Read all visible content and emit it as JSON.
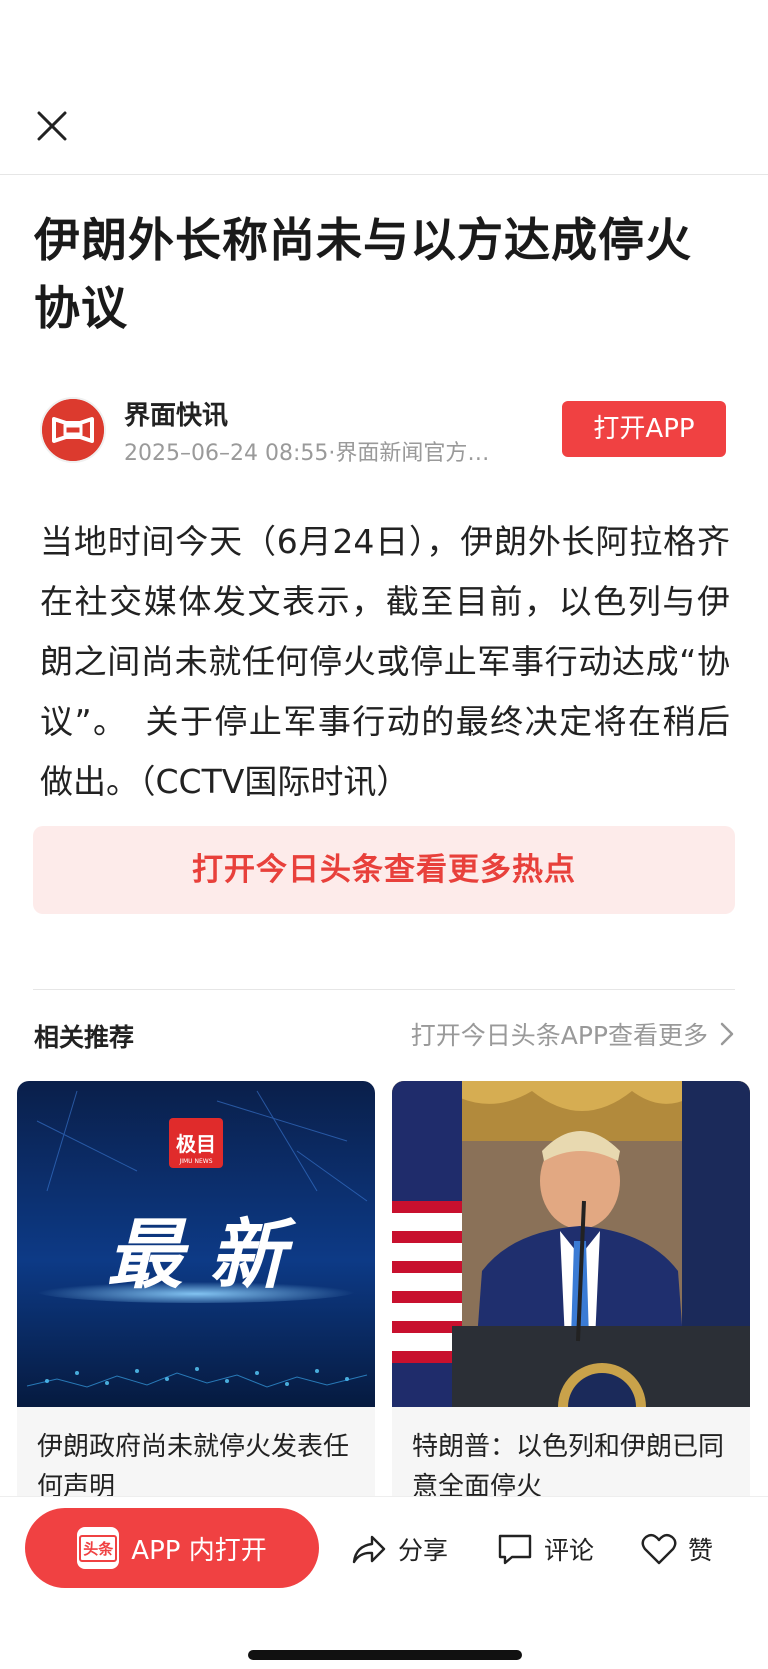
{
  "header": {
    "close_icon": "close-icon"
  },
  "article": {
    "title": "伊朗外长称尚未与以方达成停火协议",
    "author": "界面快讯",
    "meta": "2025–06–24 08:55·界面新闻官方…",
    "open_app_label": "打开APP",
    "body": "当地时间今天（6月24日），伊朗外长阿拉格齐在社交媒体发文表示，截至目前，以色列与伊朗之间尚未就任何停火或停止军事行动达成“协议”。　关于停止军事行动的最终决定将在稍后做出。（CCTV国际时讯）",
    "more_hot_label": "打开今日头条查看更多热点"
  },
  "related": {
    "title": "相关推荐",
    "more_label": "打开今日头条APP查看更多",
    "cards": [
      {
        "title": "伊朗政府尚未就停火发表任何声明",
        "img_badge": "极目",
        "img_badge_sub": "JIMU NEWS",
        "img_text": "最  新"
      },
      {
        "title": "特朗普：以色列和伊朗已同意全面停火"
      }
    ]
  },
  "bottom_bar": {
    "app_open_logo": "头条",
    "app_open_label": "APP 内打开",
    "share_label": "分享",
    "comment_label": "评论",
    "like_label": "赞"
  },
  "colors": {
    "accent": "#f04142",
    "accent_light": "#fdebea",
    "meta_gray": "#9a9a9a"
  }
}
